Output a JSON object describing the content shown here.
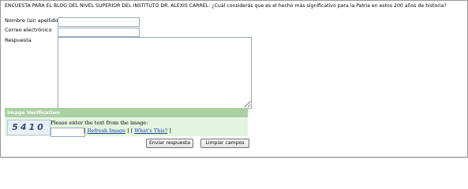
{
  "survey": {
    "question": "ENCUESTA PARA EL BLOG DEL NIVEL SUPERIOR DEL INSTITUTO DR. ALEXIS CARREL: ¿Cuál considerás que es el hecho más significativo para la Patria en estos 200 años de historia?"
  },
  "form": {
    "name_label": "Nombre (sin apellido)",
    "name_value": "",
    "email_label": "Correo electrónico",
    "email_value": "",
    "answer_label": "Respuesta",
    "answer_value": ""
  },
  "verification": {
    "header": "Image Verification",
    "captcha_text": "5410",
    "prompt": "Please enter the text from the image:",
    "input_value": "",
    "bracket_open": "[",
    "bracket_mid": "] [",
    "bracket_close": "]",
    "refresh_link": "Refresh Image",
    "whats_this_link": "What's This?"
  },
  "buttons": {
    "send_label": "Enviar respuesta",
    "clear_label": "Limpiar campos"
  }
}
